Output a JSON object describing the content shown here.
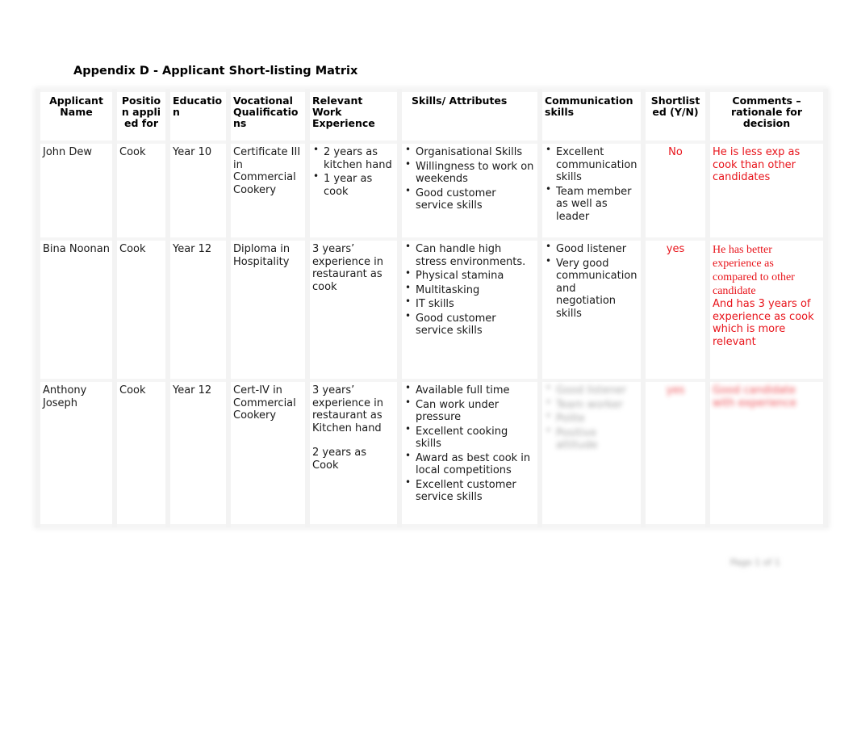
{
  "document": {
    "title": "Appendix D - Applicant Short-listing Matrix",
    "page_number": "Page 1 of 1"
  },
  "table": {
    "headers": {
      "applicant_name": "Applicant Name",
      "position": "Position applied for",
      "education": "Education",
      "vocational": "Vocational Qualifications",
      "experience": "Relevant Work Experience",
      "skills": "Skills/ Attributes",
      "communication": "Communication skills",
      "shortlisted": "Shortlisted (Y/N)",
      "comments": "Comments – rationale for decision"
    },
    "rows": [
      {
        "name": "John Dew",
        "position": "Cook",
        "education": "Year 10",
        "vocational": "Certificate III in Commercial Cookery",
        "experience": [
          "2 years as kitchen hand",
          "1 year as cook"
        ],
        "skills": [
          "Organisational Skills",
          "Willingness to work on weekends",
          "Good customer service skills"
        ],
        "communication": [
          "Excellent communication skills",
          "Team member as well as leader"
        ],
        "shortlisted": "No",
        "comments": [
          "He is less exp as cook than other candidates"
        ]
      },
      {
        "name": "Bina Noonan",
        "position": "Cook",
        "education": "Year 12",
        "vocational": "Diploma in Hospitality",
        "experience": [
          "3 years’ experience in restaurant as cook"
        ],
        "skills": [
          "Can handle high stress environments.",
          "Physical stamina",
          "Multitasking",
          "IT skills",
          "Good customer service skills"
        ],
        "communication": [
          "Good listener",
          "Very good communication and negotiation skills"
        ],
        "shortlisted": "yes",
        "comments": [
          "He has better experience as compared to other candidate",
          "And has 3 years of experience as cook which is more relevant"
        ]
      },
      {
        "name": "Anthony Joseph",
        "position": "Cook",
        "education": "Year 12",
        "vocational": "Cert-IV in Commercial Cookery",
        "experience": [
          "3 years’ experience in restaurant as Kitchen hand",
          "2 years as Cook"
        ],
        "skills": [
          "Available full time",
          "Can work under pressure",
          "Excellent cooking skills",
          "Award as best cook in local competitions",
          "Excellent customer service skills"
        ],
        "communication": [
          "Good listener",
          "Team worker",
          "Polite",
          "Positive attitude"
        ],
        "shortlisted": "yes",
        "comments": [
          "Good candidate with experience"
        ]
      }
    ]
  }
}
